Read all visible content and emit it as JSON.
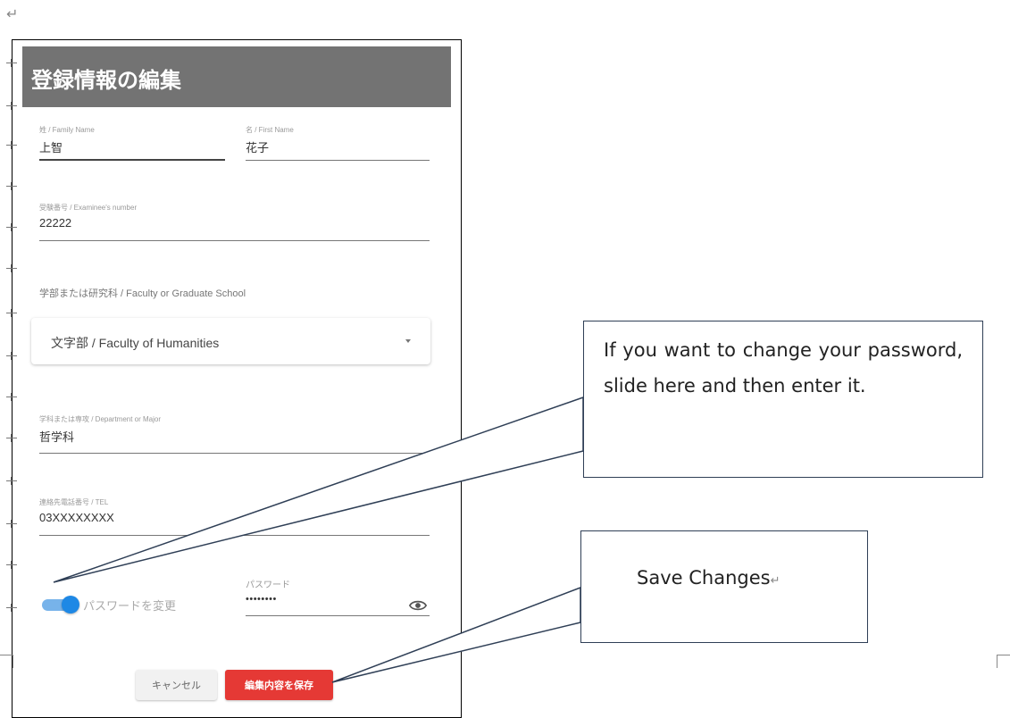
{
  "return_mark": "↵",
  "form": {
    "title": "登録情報の編集",
    "family_name": {
      "label": "姓 / Family Name",
      "value": "上智"
    },
    "first_name": {
      "label": "名 / First Name",
      "value": "花子"
    },
    "examinee_number": {
      "label": "受験番号 / Examinee's number",
      "value": "22222"
    },
    "faculty": {
      "label": "学部または研究科 / Faculty or Graduate School",
      "value": "文字部 / Faculty of Humanities"
    },
    "department": {
      "label": "学科または専攻 / Department or Major",
      "value": "哲学科"
    },
    "tel": {
      "label": "連絡先電話番号 / TEL",
      "value": "03XXXXXXXX"
    },
    "change_password_toggle": {
      "label": "パスワードを変更",
      "checked": true
    },
    "password": {
      "label": "パスワード",
      "value": "••••••••"
    },
    "cancel_button": "キャンセル",
    "save_button": "編集内容を保存"
  },
  "callouts": {
    "password": "If you want to change your password, slide here and then enter it.",
    "save": "Save Changes"
  },
  "colors": {
    "header": "#737373",
    "toggle_on": "#1e88e5",
    "save_button": "#e53935"
  },
  "icons": [
    "eye-icon",
    "dropdown-caret-icon"
  ]
}
